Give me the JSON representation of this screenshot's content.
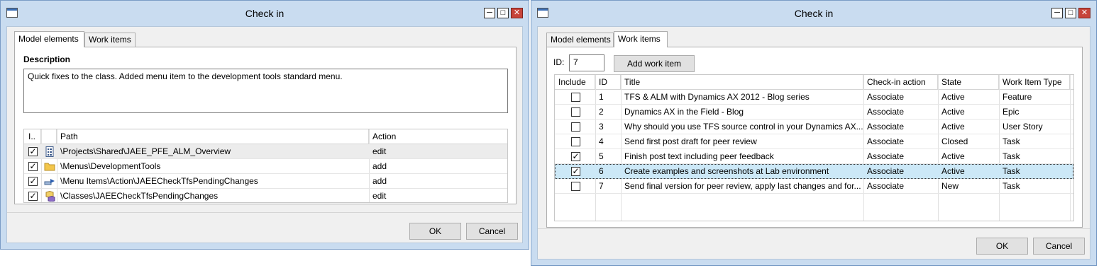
{
  "left": {
    "title": "Check in",
    "tabs": [
      "Model elements",
      "Work items"
    ],
    "description_label": "Description",
    "description_text": "Quick fixes to the class. Added menu item to the development tools standard menu.",
    "columns": [
      "I..",
      "Path",
      "Action"
    ],
    "rows": [
      {
        "path": "\\Projects\\Shared\\JAEE_PFE_ALM_Overview",
        "action": "edit",
        "icon": "project-icon"
      },
      {
        "path": "\\Menus\\DevelopmentTools",
        "action": "add",
        "icon": "folder-icon"
      },
      {
        "path": "\\Menu Items\\Action\\JAEECheckTfsPendingChanges",
        "action": "add",
        "icon": "menu-item-icon"
      },
      {
        "path": "\\Classes\\JAEECheckTfsPendingChanges",
        "action": "edit",
        "icon": "class-icon"
      }
    ],
    "ok": "OK",
    "cancel": "Cancel"
  },
  "right": {
    "title": "Check in",
    "tabs": [
      "Model elements",
      "Work items"
    ],
    "id_label": "ID:",
    "id_value": "7",
    "add_button": "Add work item",
    "columns": [
      "Include",
      "ID",
      "Title",
      "Check-in action",
      "State",
      "Work Item Type"
    ],
    "rows": [
      {
        "checked": false,
        "id": "1",
        "title": "TFS & ALM with Dynamics AX 2012 - Blog series",
        "action": "Associate",
        "state": "Active",
        "type": "Feature"
      },
      {
        "checked": false,
        "id": "2",
        "title": "Dynamics AX in the Field - Blog",
        "action": "Associate",
        "state": "Active",
        "type": "Epic"
      },
      {
        "checked": false,
        "id": "3",
        "title": "Why should you use TFS source control in your Dynamics AX...",
        "action": "Associate",
        "state": "Active",
        "type": "User Story"
      },
      {
        "checked": false,
        "id": "4",
        "title": "Send first post draft for peer review",
        "action": "Associate",
        "state": "Closed",
        "type": "Task"
      },
      {
        "checked": true,
        "id": "5",
        "title": "Finish post text including peer feedback",
        "action": "Associate",
        "state": "Active",
        "type": "Task"
      },
      {
        "checked": true,
        "id": "6",
        "title": "Create examples and screenshots at Lab environment",
        "action": "Associate",
        "state": "Active",
        "type": "Task"
      },
      {
        "checked": false,
        "id": "7",
        "title": "Send final version for peer review, apply last changes and for...",
        "action": "Associate",
        "state": "New",
        "type": "Task"
      }
    ],
    "ok": "OK",
    "cancel": "Cancel"
  }
}
